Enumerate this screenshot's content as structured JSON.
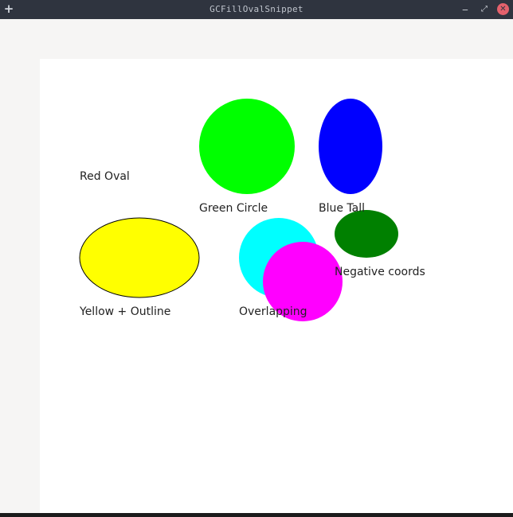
{
  "window": {
    "title": "GCFillOvalSnippet",
    "pin_icon": "+",
    "minimize_icon": "‒",
    "maximize_icon": "⤢",
    "close_icon": "✕"
  },
  "labels": {
    "red_oval": "Red Oval",
    "green_circle": "Green Circle",
    "blue_tall": "Blue Tall",
    "yellow_outline": "Yellow + Outline",
    "overlapping": "Overlapping",
    "negative_coords": "Negative coords"
  },
  "colors": {
    "green": "#00ff00",
    "blue": "#0000ff",
    "yellow": "#ffff00",
    "cyan": "#00ffff",
    "magenta": "#ff00ff",
    "dark_green": "#008000",
    "outline": "#000000",
    "canvas": "#ffffff"
  }
}
